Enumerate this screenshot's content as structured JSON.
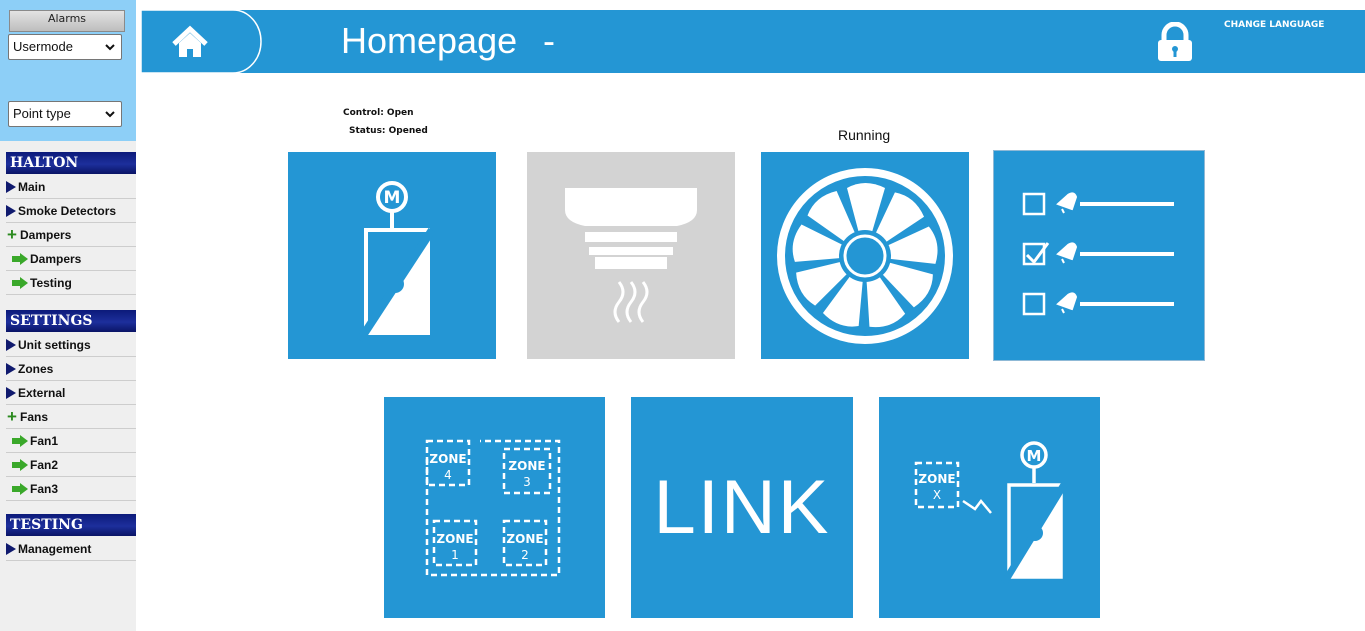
{
  "sidebar": {
    "alarms_label": "Alarms",
    "usermode_select": "Usermode",
    "pointtype_select": "Point type",
    "sections": [
      {
        "title": "HALTON",
        "items": [
          {
            "label": "Main",
            "icon": "triangle-icon"
          },
          {
            "label": "Smoke Detectors",
            "icon": "triangle-icon"
          },
          {
            "label": "Dampers",
            "icon": "plus-icon"
          },
          {
            "label": "Dampers",
            "icon": "green-arrow-icon"
          },
          {
            "label": "Testing",
            "icon": "green-arrow-icon"
          }
        ]
      },
      {
        "title": "SETTINGS",
        "items": [
          {
            "label": "Unit settings",
            "icon": "triangle-icon"
          },
          {
            "label": "Zones",
            "icon": "triangle-icon"
          },
          {
            "label": "External",
            "icon": "triangle-icon"
          },
          {
            "label": "Fans",
            "icon": "plus-icon"
          },
          {
            "label": "Fan1",
            "icon": "green-arrow-icon"
          },
          {
            "label": "Fan2",
            "icon": "green-arrow-icon"
          },
          {
            "label": "Fan3",
            "icon": "green-arrow-icon"
          }
        ]
      },
      {
        "title": "TESTING",
        "items": [
          {
            "label": "Management",
            "icon": "triangle-icon"
          }
        ]
      }
    ]
  },
  "header": {
    "title": "Homepage",
    "title_suffix": "-",
    "change_language": "CHANGE LANGUAGE"
  },
  "status": {
    "control": "Control: Open",
    "status": "Status: Opened",
    "running": "Running"
  },
  "tiles": {
    "link_label": "LINK",
    "zone_labels": [
      "ZONE",
      "ZONE",
      "ZONE",
      "ZONE",
      "ZONE"
    ],
    "zone_numbers": [
      "4",
      "3",
      "1",
      "2",
      "X"
    ],
    "motor_label": "M"
  },
  "colors": {
    "accent": "#2496d4",
    "sidebar_top": "#8dcff7",
    "nav_header": "#0c1a7a",
    "disabled_tile": "#d3d3d3"
  }
}
